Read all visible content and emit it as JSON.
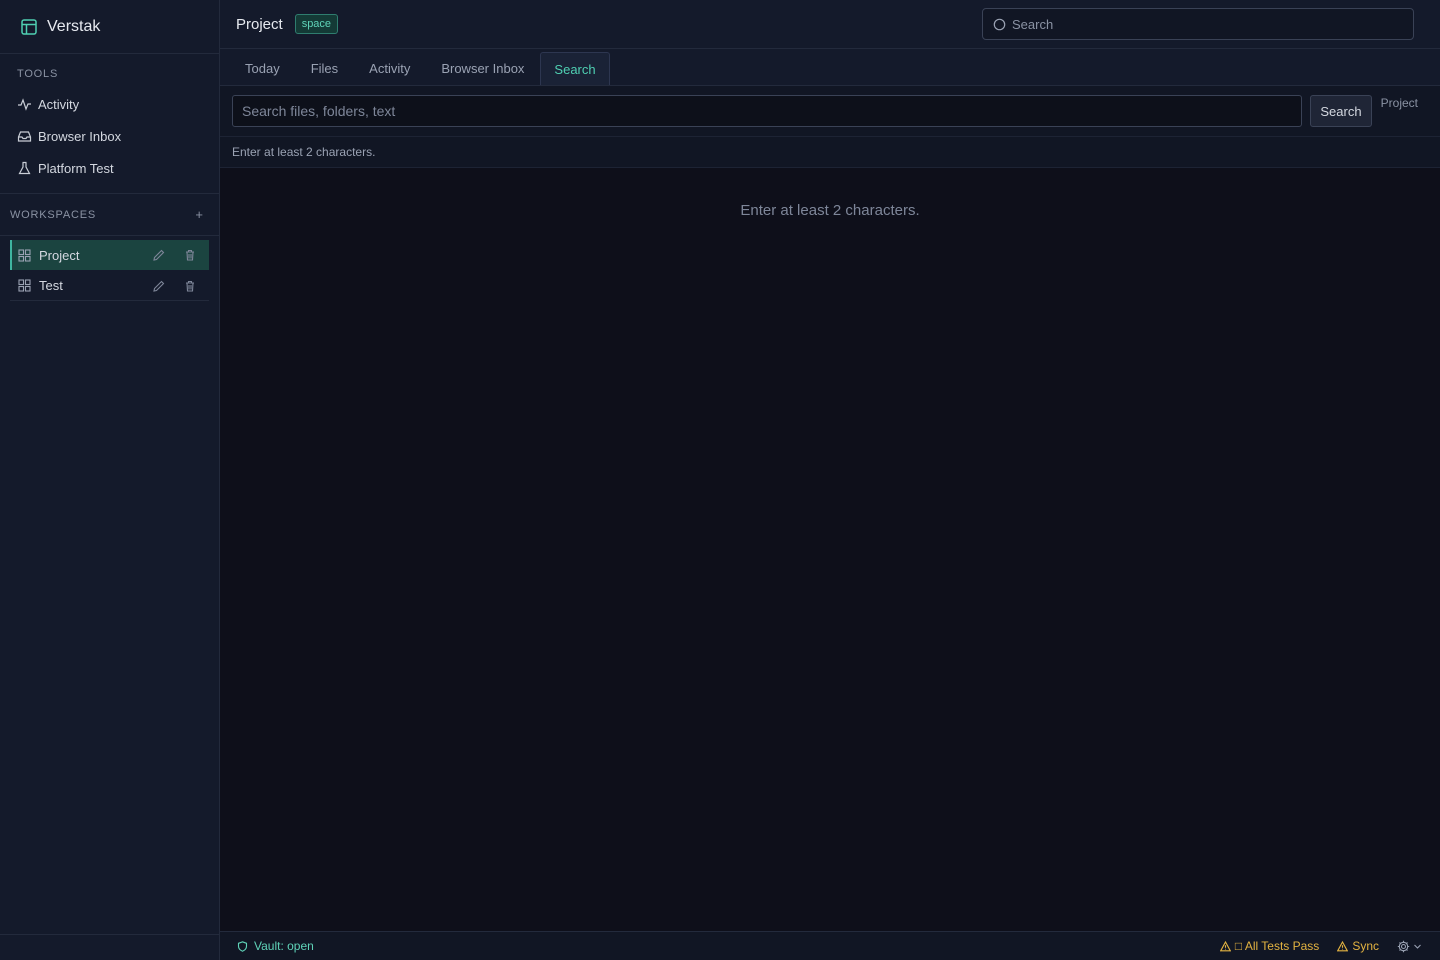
{
  "app": {
    "name": "Verstak"
  },
  "sidebar": {
    "tools_label": "TOOLS",
    "tools": [
      {
        "label": "Activity",
        "icon": "activity-icon"
      },
      {
        "label": "Browser Inbox",
        "icon": "inbox-icon"
      },
      {
        "label": "Platform Test",
        "icon": "flask-icon"
      }
    ],
    "workspaces_label": "WORKSPACES",
    "add_label": "+",
    "workspaces": [
      {
        "label": "Project",
        "active": true
      },
      {
        "label": "Test",
        "active": false
      }
    ]
  },
  "header": {
    "title": "Project",
    "badge": "space",
    "search_placeholder": "Search"
  },
  "tabs": [
    {
      "label": "Today",
      "active": false
    },
    {
      "label": "Files",
      "active": false
    },
    {
      "label": "Activity",
      "active": false
    },
    {
      "label": "Browser Inbox",
      "active": false
    },
    {
      "label": "Search",
      "active": true
    }
  ],
  "search": {
    "placeholder": "Search files, folders, text",
    "value": "",
    "button_label": "Search",
    "scope": "Project",
    "hint": "Enter at least 2 characters.",
    "empty_message": "Enter at least 2 characters."
  },
  "status": {
    "vault": "Vault: open",
    "tests": "□ All Tests Pass",
    "sync": "Sync"
  },
  "colors": {
    "accent": "#4fcfb2",
    "warning": "#e3b341",
    "active_bg": "#1b4440"
  }
}
